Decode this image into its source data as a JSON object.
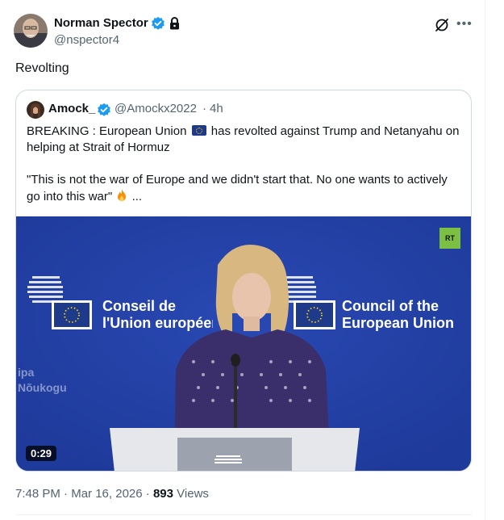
{
  "tweet": {
    "author_name": "Norman Spector",
    "author_handle": "@nspector4",
    "text": "Revolting"
  },
  "quoted_tweet": {
    "author_name": "Amock_",
    "author_handle": "@Amockx2022",
    "separator": "·",
    "time": "4h",
    "line1_before_flag": "BREAKING : European Union",
    "line1_after_flag": "has revolted against Trump and Netanyahu on",
    "line2": "helping at Strait of Hormuz",
    "line3": "\"This is not the war of Europe and we didn't start that. No one wants to actively",
    "line4_before_emoji": "go into this war\"",
    "line4_after_emoji": "...",
    "media": {
      "duration": "0:29",
      "logo_text": "RT",
      "sign_left_line1": "Conseil de",
      "sign_left_line2": "l'Union européenne",
      "sign_right_line1": "Council of the",
      "sign_right_line2": "European Union",
      "sign_bottom_line1": "ipa",
      "sign_bottom_line2": "Nõukogu"
    }
  },
  "footer": {
    "time": "7:48 PM",
    "separator1": "·",
    "date": "Mar 16, 2026",
    "separator2": "·",
    "views_count": "893",
    "views_label": "Views"
  },
  "icons": {
    "verified": "verified-badge-icon",
    "lock": "lock-icon",
    "grok": "grok-icon",
    "more": "more-icon",
    "fire": "fire-icon",
    "eu_flag": "eu-flag-icon"
  },
  "colors": {
    "verified_blue": "#1d9bf0",
    "secondary_text": "#536471",
    "eu_blue": "#2341a8",
    "rt_green": "#7bc043"
  }
}
